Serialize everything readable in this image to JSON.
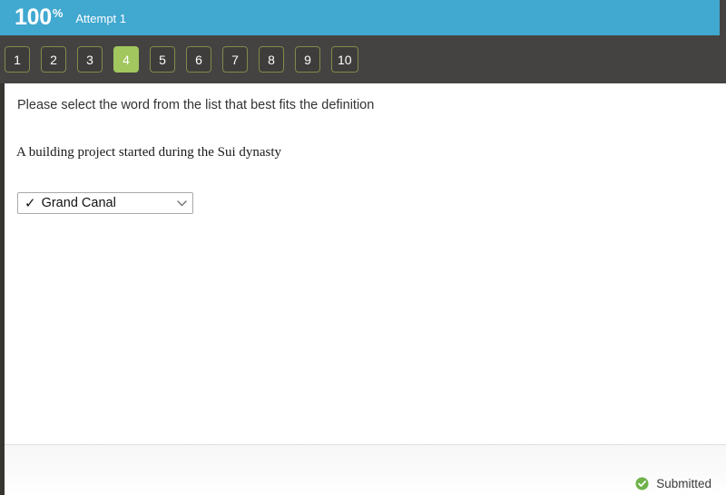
{
  "score_bar": {
    "score_value": "100",
    "score_unit": "%",
    "attempt_label": "Attempt 1",
    "background_color": "#41a8d0"
  },
  "navigation": {
    "background_color": "#454341",
    "current_index": 3,
    "active_color": "#a2c75f",
    "border_color": "#808a4b",
    "questions": [
      {
        "label": "1",
        "current": false
      },
      {
        "label": "2",
        "current": false
      },
      {
        "label": "3",
        "current": false
      },
      {
        "label": "4",
        "current": true
      },
      {
        "label": "5",
        "current": false
      },
      {
        "label": "6",
        "current": false
      },
      {
        "label": "7",
        "current": false
      },
      {
        "label": "8",
        "current": false
      },
      {
        "label": "9",
        "current": false
      },
      {
        "label": "10",
        "current": false
      }
    ]
  },
  "question": {
    "stem": "Please select the word from the list that best fits the definition",
    "definition": "A building project started during the Sui dynasty",
    "answer": {
      "check_glyph": "✓",
      "selected_value": "Grand Canal",
      "chevron_icon": "chevron-down-icon"
    }
  },
  "footer": {
    "status_icon": "check-circle-icon",
    "status_label": "Submitted",
    "status_color": "#70b24a"
  }
}
